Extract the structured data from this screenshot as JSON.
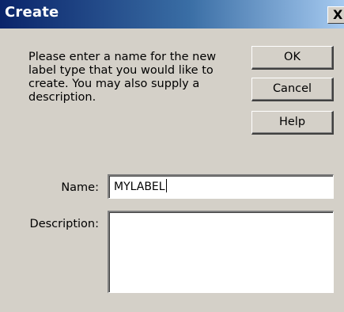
{
  "dialog": {
    "title": "Create",
    "close_glyph": "X",
    "prompt": "Please enter a name for the new label type that you would like to create. You may also supply a description.",
    "buttons": {
      "ok": "OK",
      "cancel": "Cancel",
      "help": "Help"
    },
    "name_label": "Name:",
    "name_value": "MYLABEL",
    "description_label": "Description:",
    "description_value": ""
  },
  "colors": {
    "window_bg": "#d4d0c8",
    "titlebar_start": "#0a246a",
    "titlebar_end": "#a6caf0"
  },
  "icons": {
    "close": "close-icon"
  }
}
